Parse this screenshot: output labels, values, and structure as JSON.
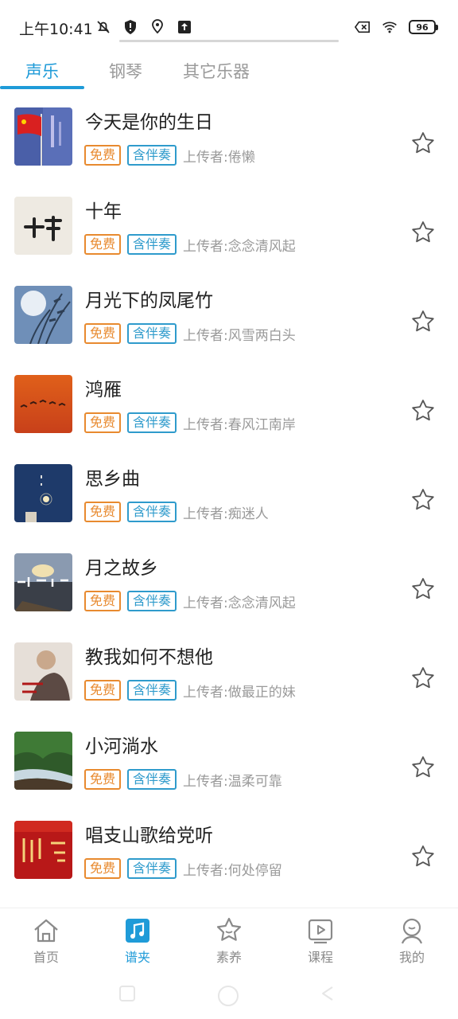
{
  "status_bar": {
    "time": "上午10:41",
    "battery": "96"
  },
  "tabs": [
    {
      "label": "声乐",
      "active": true
    },
    {
      "label": "钢琴",
      "active": false
    },
    {
      "label": "其它乐器",
      "active": false
    }
  ],
  "songs": [
    {
      "title": "今天是你的生日",
      "tag_free": "免费",
      "tag_acc": "含伴奏",
      "uploader": "上传者:倦懒"
    },
    {
      "title": "十年",
      "tag_free": "免费",
      "tag_acc": "含伴奏",
      "uploader": "上传者:念念清风起"
    },
    {
      "title": "月光下的凤尾竹",
      "tag_free": "免费",
      "tag_acc": "含伴奏",
      "uploader": "上传者:风雪两白头"
    },
    {
      "title": "鸿雁",
      "tag_free": "免费",
      "tag_acc": "含伴奏",
      "uploader": "上传者:春风江南岸"
    },
    {
      "title": "思乡曲",
      "tag_free": "免费",
      "tag_acc": "含伴奏",
      "uploader": "上传者:痴迷人"
    },
    {
      "title": "月之故乡",
      "tag_free": "免费",
      "tag_acc": "含伴奏",
      "uploader": "上传者:念念清风起"
    },
    {
      "title": "教我如何不想他",
      "tag_free": "免费",
      "tag_acc": "含伴奏",
      "uploader": "上传者:做最正的妹"
    },
    {
      "title": "小河淌水",
      "tag_free": "免费",
      "tag_acc": "含伴奏",
      "uploader": "上传者:温柔可靠"
    },
    {
      "title": "唱支山歌给党听",
      "tag_free": "免费",
      "tag_acc": "含伴奏",
      "uploader": "上传者:何处停留"
    }
  ],
  "bottom_nav": [
    {
      "label": "首页",
      "icon": "home-icon",
      "active": false
    },
    {
      "label": "谱夹",
      "icon": "music-folder-icon",
      "active": true
    },
    {
      "label": "素养",
      "icon": "star-face-icon",
      "active": false
    },
    {
      "label": "课程",
      "icon": "play-video-icon",
      "active": false
    },
    {
      "label": "我的",
      "icon": "profile-icon",
      "active": false
    }
  ],
  "colors": {
    "accent": "#1f9bd8",
    "tag_free": "#e88a2f",
    "tag_accompaniment": "#2f9bcc",
    "muted": "#9a9a9a"
  }
}
